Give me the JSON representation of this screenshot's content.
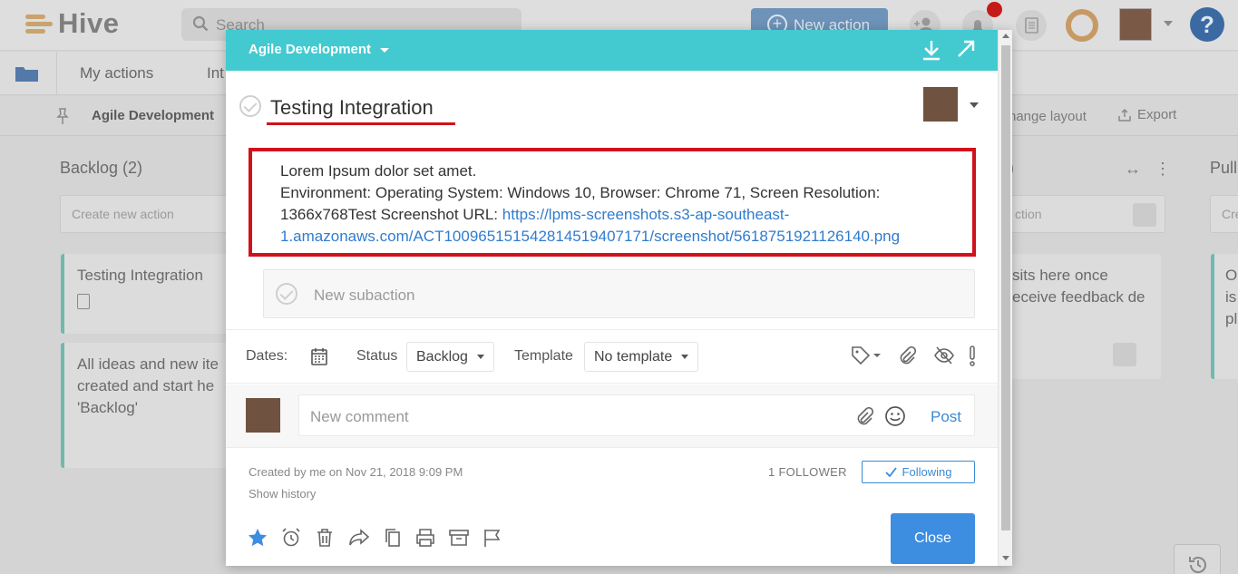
{
  "app": {
    "logo": "Hive",
    "search_placeholder": "Search",
    "new_action": "New action"
  },
  "nav": {
    "my_actions": "My actions",
    "int": "Int"
  },
  "subbar": {
    "project": "Agile Development",
    "change_layout": "hange layout",
    "export": "Export"
  },
  "board": {
    "backlog_title": "Backlog (2)",
    "mid_title": ")",
    "pull_title": "Pull",
    "create_new_action": "Create new action",
    "create_new_action_mid": "ction",
    "create_new_action_right": "Cre",
    "card1": "Testing Integration",
    "card2": "All ideas and new ite created and start he 'Backlog'",
    "card_mid": "sits here once eceive feedback de",
    "card_right": "O is pl"
  },
  "modal": {
    "project": "Agile Development",
    "title": "Testing Integration",
    "desc_line1": "Lorem Ipsum dolor set amet.",
    "desc_line2": "Environment: Operating System: Windows 10, Browser: Chrome 71, Screen Resolution:",
    "desc_line3_prefix": "1366x768Test Screenshot URL: ",
    "desc_link_a": "https://lpms-screenshots.s3-ap-southeast-",
    "desc_link_b": "1.amazonaws.com/ACT100965151542814519407171/screenshot/5618751921126140.png",
    "new_subaction": "New subaction",
    "dates_label": "Dates:",
    "status_label": "Status",
    "status_value": "Backlog",
    "template_label": "Template",
    "template_value": "No template",
    "comment_placeholder": "New comment",
    "post": "Post",
    "created": "Created by me on Nov 21, 2018 9:09 PM",
    "show_history": "Show history",
    "followers": "1 FOLLOWER",
    "following": "Following",
    "close": "Close"
  },
  "colors": {
    "header": "#43cad0",
    "accent_blue": "#3d8de0",
    "highlight_red": "#d0121b"
  }
}
